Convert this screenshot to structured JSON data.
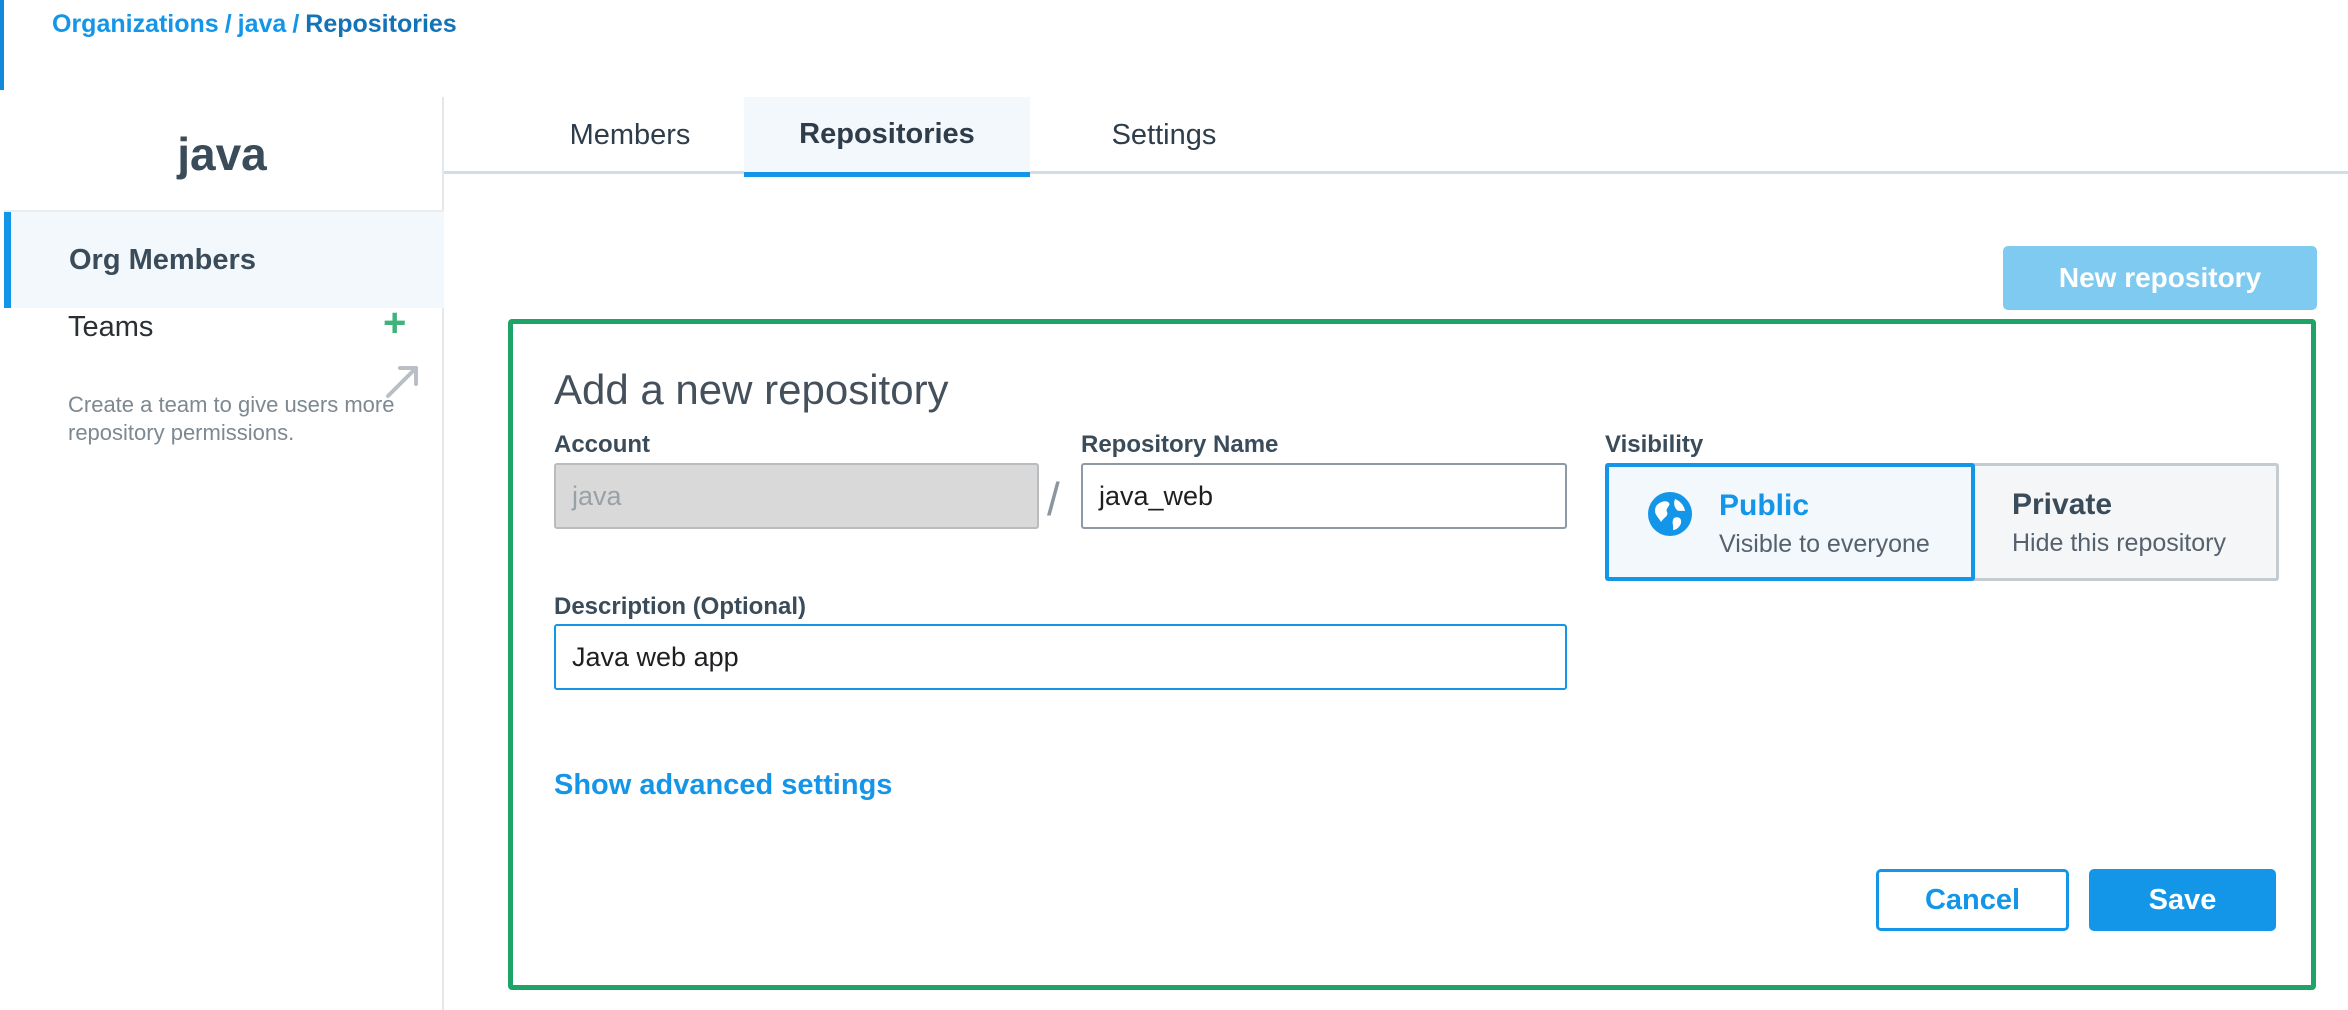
{
  "breadcrumb": {
    "organizations": "Organizations",
    "separator": "/",
    "org": "java",
    "current": "Repositories"
  },
  "sidebar": {
    "org_name": "java",
    "items": [
      {
        "label": "Org Members",
        "active": true
      },
      {
        "label": "Teams",
        "active": false
      }
    ],
    "teams_add_icon": "plus-icon",
    "teams_help": "Create a team to give users more repository permissions."
  },
  "tabs": [
    {
      "label": "Members",
      "active": false
    },
    {
      "label": "Repositories",
      "active": true
    },
    {
      "label": "Settings",
      "active": false
    }
  ],
  "new_repository_button": "New repository",
  "form": {
    "title": "Add a new repository",
    "account_label": "Account",
    "account_value": "java",
    "slash": "/",
    "repo_name_label": "Repository Name",
    "repo_name_value": "java_web",
    "visibility_label": "Visibility",
    "visibility_options": [
      {
        "title": "Public",
        "subtitle": "Visible to everyone",
        "selected": true,
        "icon": "globe-icon"
      },
      {
        "title": "Private",
        "subtitle": "Hide this repository",
        "selected": false
      }
    ],
    "description_label": "Description (Optional)",
    "description_value": "Java web app",
    "advanced_link": "Show advanced settings",
    "cancel_label": "Cancel",
    "save_label": "Save"
  },
  "colors": {
    "accent": "#1496e8",
    "panel_border": "#1ea466",
    "add_icon": "#3fb37a",
    "new_repo_button": "#7fcaf0"
  }
}
